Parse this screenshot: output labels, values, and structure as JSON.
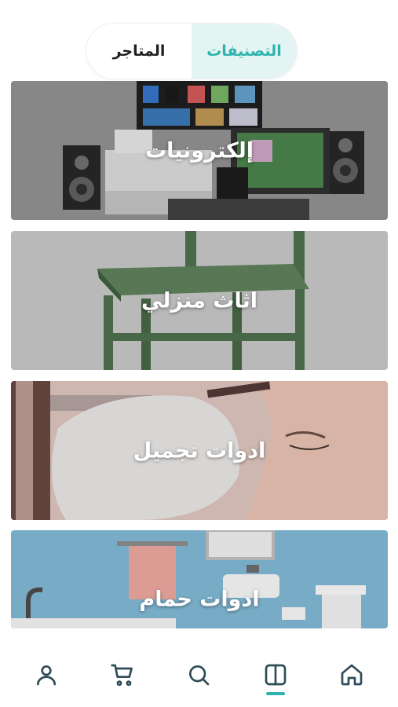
{
  "tabs": {
    "stores_label": "المتاجر",
    "categories_label": "التصنيفات",
    "active": "categories"
  },
  "categories": [
    {
      "label": "إلكترونيات"
    },
    {
      "label": "اثاث منزلي"
    },
    {
      "label": "ادوات تجميل"
    },
    {
      "label": "ادوات حمام"
    }
  ],
  "bottom_nav": {
    "items": [
      {
        "icon": "profile-icon"
      },
      {
        "icon": "cart-icon"
      },
      {
        "icon": "search-icon"
      },
      {
        "icon": "categories-icon"
      },
      {
        "icon": "home-icon"
      }
    ],
    "active": "categories-icon"
  },
  "colors": {
    "accent": "#2fb3ad",
    "accent_bg": "#e3f4f3",
    "icon": "#2e4c57"
  }
}
